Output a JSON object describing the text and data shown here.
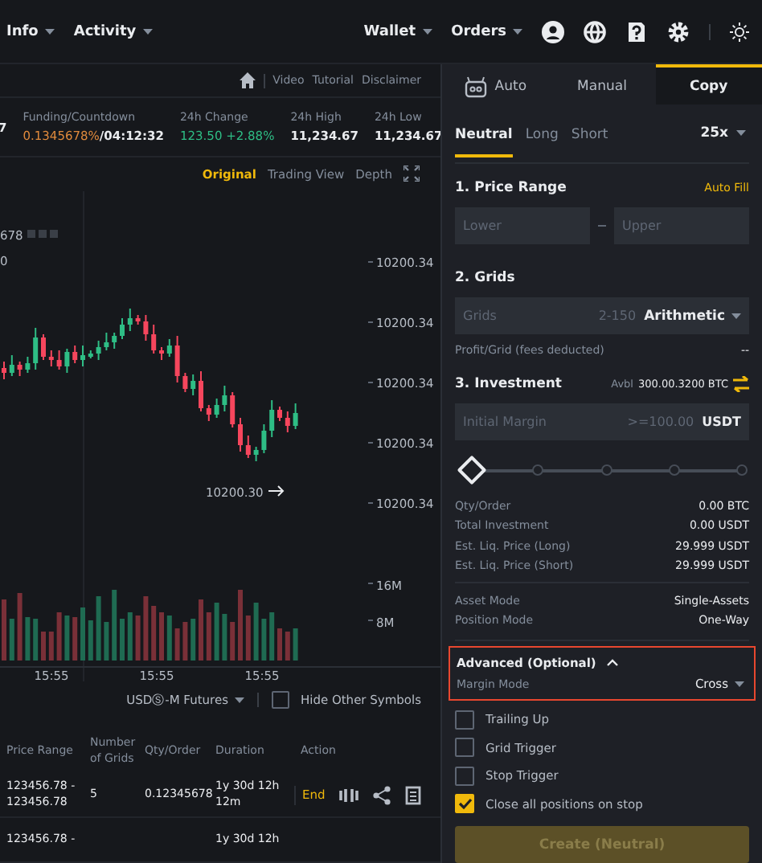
{
  "nav": {
    "left": [
      {
        "label": "Info"
      },
      {
        "label": "Activity"
      }
    ],
    "right": [
      {
        "label": "Wallet"
      },
      {
        "label": "Orders"
      }
    ]
  },
  "subheader": {
    "links": [
      "Video",
      "Tutorial",
      "Disclaimer"
    ]
  },
  "ticker": {
    "cut_value": "7",
    "stats": [
      {
        "kind": "funding",
        "label": "Funding/Countdown",
        "rate": "0.1345678%",
        "countdown": "/04:12:32"
      },
      {
        "kind": "change",
        "label": "24h Change",
        "value": "123.50 +2.88%"
      },
      {
        "kind": "plain",
        "label": "24h High",
        "value": "11,234.67"
      },
      {
        "kind": "plain",
        "label": "24h Low",
        "value": "11,234.67"
      }
    ]
  },
  "chart_views": [
    {
      "label": "Original",
      "selected": true
    },
    {
      "label": "Trading View",
      "selected": false
    },
    {
      "label": "Depth",
      "selected": false
    }
  ],
  "chart": {
    "legend": "678",
    "legend_2": "0",
    "price_labels": [
      "10200.34",
      "10200.34",
      "10200.34",
      "10200.34",
      "10200.34"
    ],
    "last_price": "10200.30",
    "volume_labels": [
      "16M",
      "8M"
    ],
    "time_labels": [
      "15:55",
      "15:55",
      "15:55"
    ]
  },
  "filters": {
    "market": "USDⓈ-M Futures",
    "hide_other": {
      "label": "Hide Other Symbols",
      "checked": false
    }
  },
  "table": {
    "columns": [
      "Price Range",
      "Number of Grids",
      "Qty/Order",
      "Duration",
      "Action"
    ],
    "rows": [
      {
        "price_range": "123456.78 - 123456.78",
        "grids": "5",
        "qty": "0.12345678",
        "duration": "1y 30d 12h 12m",
        "action": "End"
      },
      {
        "price_range": "123456.78 -",
        "grids": "",
        "qty": "",
        "duration": "1y 30d 12h",
        "action": ""
      }
    ]
  },
  "mode_tabs": [
    {
      "label": "Auto",
      "selected": false
    },
    {
      "label": "Manual",
      "selected": false
    },
    {
      "label": "Copy",
      "selected": true
    }
  ],
  "direction_tabs": [
    {
      "label": "Neutral",
      "selected": true
    },
    {
      "label": "Long",
      "selected": false
    },
    {
      "label": "Short",
      "selected": false
    }
  ],
  "leverage": "25x",
  "price_range": {
    "title": "1. Price Range",
    "auto_fill": "Auto Fill",
    "lower": {
      "placeholder": "Lower"
    },
    "upper": {
      "placeholder": "Upper"
    }
  },
  "grids": {
    "title": "2. Grids",
    "field": {
      "placeholder": "Grids"
    },
    "range": "2-150",
    "type": "Arithmetic",
    "profit_label": "Profit/Grid (fees deducted)",
    "profit_value": "--"
  },
  "investment": {
    "title": "3. Investment",
    "avbl_label": "Avbl",
    "avbl_value": "300.00.3200 BTC",
    "field": {
      "placeholder": "Initial Margin"
    },
    "min": ">=100.00",
    "unit": "USDT",
    "slider": {
      "level": 0
    }
  },
  "summary": [
    {
      "label": "Qty/Order",
      "value": "0.00 BTC"
    },
    {
      "label": "Total Investment",
      "value": "0.00 USDT"
    },
    {
      "label": "Est. Liq. Price (Long)",
      "value": "29.999 USDT"
    },
    {
      "label": "Est. Liq. Price (Short)",
      "value": "29.999 USDT"
    }
  ],
  "modes": [
    {
      "label": "Asset Mode",
      "value": "Single-Assets"
    },
    {
      "label": "Position Mode",
      "value": "One-Way"
    }
  ],
  "advanced": {
    "title": "Advanced (Optional)",
    "expanded": true,
    "margin_label": "Margin Mode",
    "margin_value": "Cross"
  },
  "options": [
    {
      "label": "Trailing Up",
      "checked": false
    },
    {
      "label": "Grid Trigger",
      "checked": false
    },
    {
      "label": "Stop Trigger",
      "checked": false
    },
    {
      "label": "Close all positions on stop",
      "checked": true
    }
  ],
  "create_button": {
    "label": "Create (Neutral)",
    "disabled": true
  }
}
